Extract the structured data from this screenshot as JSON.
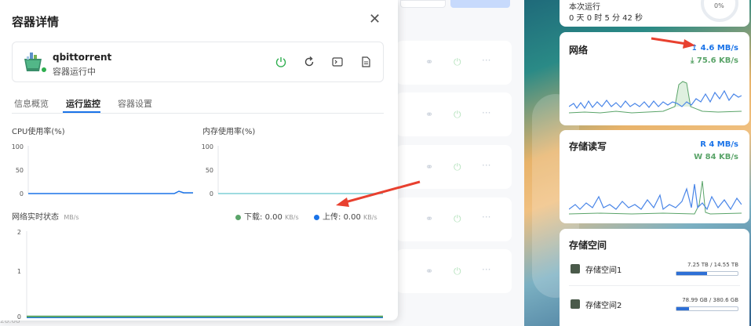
{
  "modal": {
    "title": "容器详情",
    "app_name": "qbittorrent",
    "app_status": "容器运行中",
    "tabs": [
      "信息概览",
      "运行监控",
      "容器设置"
    ],
    "cpu": {
      "label": "CPU使用率(%)",
      "yticks": [
        "100",
        "50",
        "0"
      ]
    },
    "mem": {
      "label": "内存使用率(%)",
      "yticks": [
        "100",
        "50",
        "0"
      ]
    },
    "net": {
      "label": "网络实时状态",
      "unit": "MB/s",
      "download_label": "下载:",
      "download_value": "0.00",
      "upload_label": "上传:",
      "upload_value": "0.00",
      "rate_unit": "KB/s",
      "yticks": [
        "2",
        "1",
        "0"
      ]
    }
  },
  "background": {
    "bottom_text": "28.68"
  },
  "widgets": {
    "uptime": {
      "label": "本次运行",
      "value": "0 天 0 时 5 分 42 秒",
      "percent": "0%"
    },
    "network": {
      "title": "网络",
      "upload": "↥ 4.6 MB/s",
      "download": "⤓ 75.6 KB/s"
    },
    "disk_io": {
      "title": "存储读写",
      "read": "R  4 MB/s",
      "write": "W 84 KB/s"
    },
    "storage": {
      "title": "存储空间",
      "items": [
        {
          "name": "存储空间1",
          "usage": "7.25 TB / 14.55 TB",
          "fraction": 0.5
        },
        {
          "name": "存储空间2",
          "usage": "78.99 GB / 380.6 GB",
          "fraction": 0.21
        }
      ]
    }
  },
  "colors": {
    "accent": "#1a73e8",
    "green": "#2eae4e",
    "download": "#5aa469",
    "upload": "#1a73e8",
    "arrow": "#e8402f"
  }
}
